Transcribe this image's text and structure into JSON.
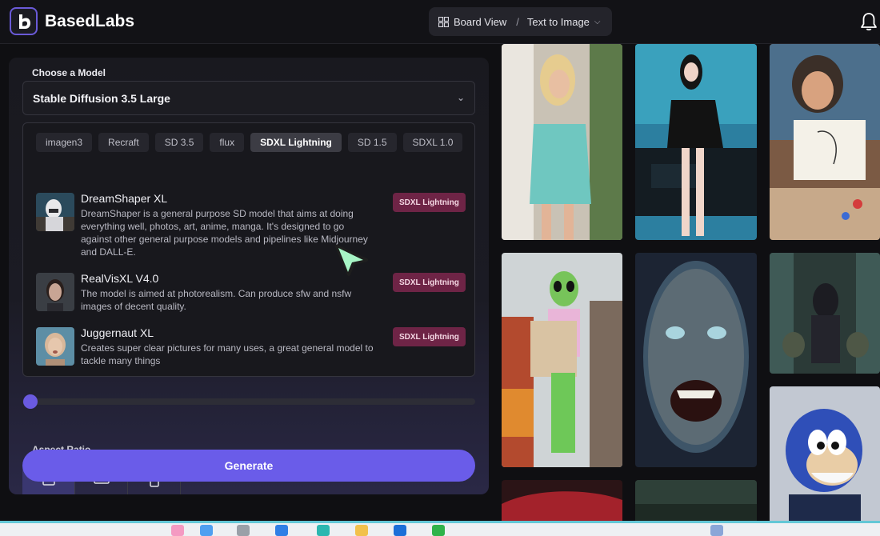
{
  "app": {
    "name": "BasedLabs"
  },
  "breadcrumb": {
    "board": "Board View",
    "separator": "/",
    "current": "Text to Image"
  },
  "model_section": {
    "label": "Choose a Model",
    "selected": "Stable Diffusion 3.5 Large",
    "categories": [
      "imagen3",
      "Recraft",
      "SD 3.5",
      "flux",
      "SDXL Lightning",
      "SD 1.5",
      "SDXL 1.0"
    ],
    "active_category": "SDXL Lightning",
    "models": [
      {
        "title": "DreamShaper XL",
        "desc": "DreamShaper is a general purpose SD model that aims at doing everything well, photos, art, anime, manga. It's designed to go against other general purpose models and pipelines like Midjourney and DALL-E.",
        "badge": "SDXL Lightning"
      },
      {
        "title": "RealVisXL V4.0",
        "desc": "The model is aimed at photorealism. Can produce sfw and nsfw images of decent quality.",
        "badge": "SDXL Lightning"
      },
      {
        "title": "Juggernaut XL",
        "desc": "Creates super clear pictures for many uses, a great general model to tackle many things",
        "badge": "SDXL Lightning"
      }
    ]
  },
  "aspect": {
    "label": "Aspect Ratio"
  },
  "generate": {
    "label": "Generate"
  },
  "icons": [
    "logo-icon",
    "grid-icon",
    "chevron-down-icon",
    "bell-icon",
    "cursor-icon"
  ],
  "colors": {
    "accent": "#6a5ce9",
    "badge": "#6e2446",
    "background": "#0f0f12"
  }
}
